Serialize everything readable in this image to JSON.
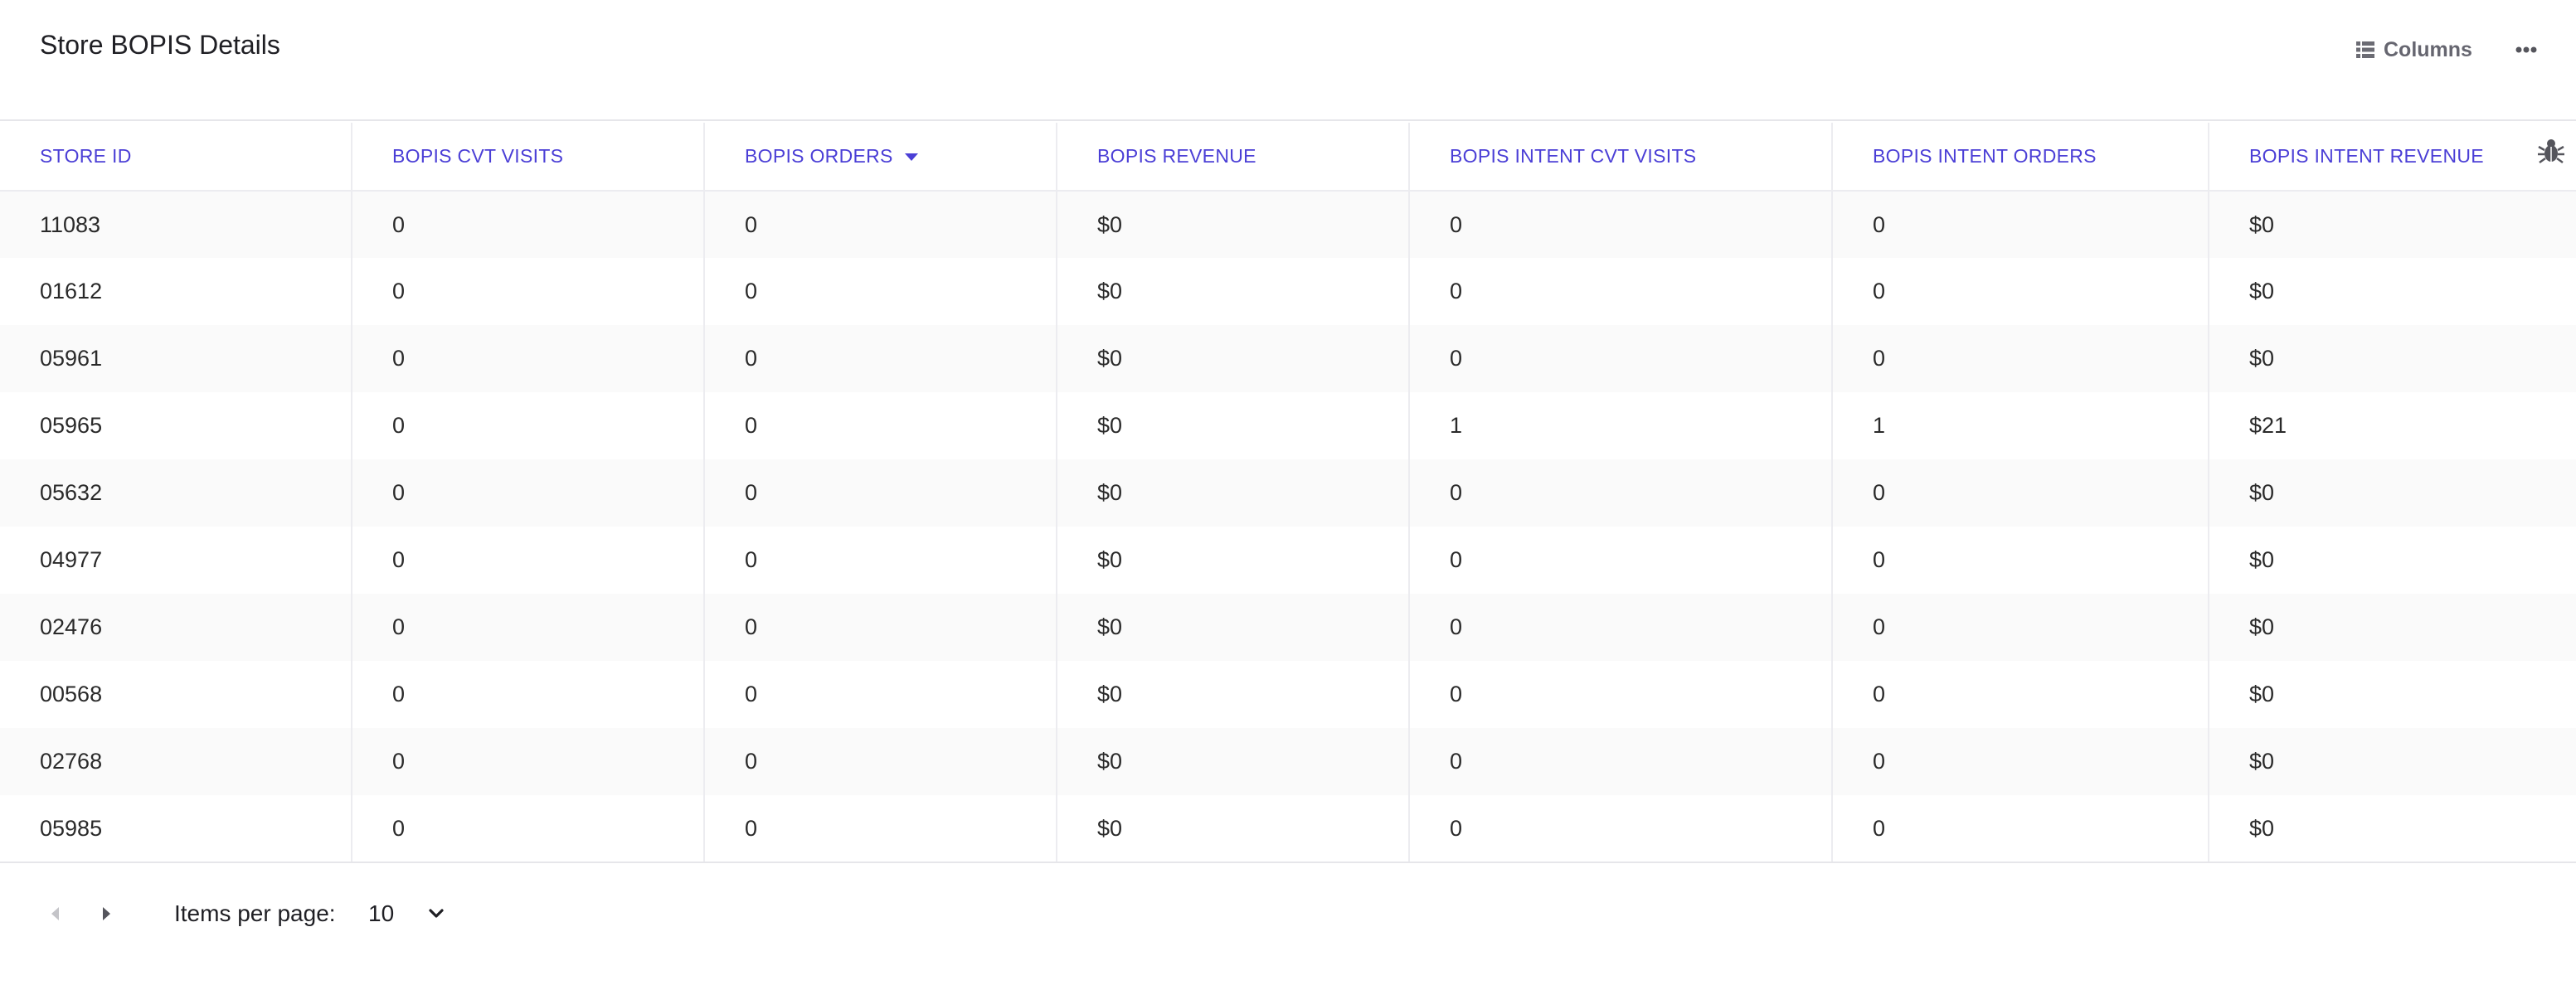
{
  "page": {
    "title": "Store BOPIS Details"
  },
  "toolbar": {
    "columns_label": "Columns",
    "columns_icon": "table-columns-icon",
    "more_icon": "more-horizontal-icon",
    "debug_icon": "bug-icon"
  },
  "table": {
    "headers": [
      "STORE ID",
      "BOPIS CVT VISITS",
      "BOPIS ORDERS",
      "BOPIS REVENUE",
      "BOPIS INTENT CVT VISITS",
      "BOPIS INTENT ORDERS",
      "BOPIS INTENT REVENUE"
    ],
    "sorted_column": "BOPIS ORDERS",
    "sort_direction": "descending",
    "rows": [
      [
        "11083",
        "0",
        "0",
        "$0",
        "0",
        "0",
        "$0"
      ],
      [
        "01612",
        "0",
        "0",
        "$0",
        "0",
        "0",
        "$0"
      ],
      [
        "05961",
        "0",
        "0",
        "$0",
        "0",
        "0",
        "$0"
      ],
      [
        "05965",
        "0",
        "0",
        "$0",
        "1",
        "1",
        "$21"
      ],
      [
        "05632",
        "0",
        "0",
        "$0",
        "0",
        "0",
        "$0"
      ],
      [
        "04977",
        "0",
        "0",
        "$0",
        "0",
        "0",
        "$0"
      ],
      [
        "02476",
        "0",
        "0",
        "$0",
        "0",
        "0",
        "$0"
      ],
      [
        "00568",
        "0",
        "0",
        "$0",
        "0",
        "0",
        "$0"
      ],
      [
        "02768",
        "0",
        "0",
        "$0",
        "0",
        "0",
        "$0"
      ],
      [
        "05985",
        "0",
        "0",
        "$0",
        "0",
        "0",
        "$0"
      ]
    ]
  },
  "pagination": {
    "items_per_page_label": "Items per page:",
    "items_per_page_value": "10",
    "prev_icon": "caret-left-icon",
    "next_icon": "caret-right-icon"
  },
  "colors": {
    "header_text": "#4b3fd6",
    "zebra_row": "#fafafa",
    "border": "#ececf0"
  }
}
